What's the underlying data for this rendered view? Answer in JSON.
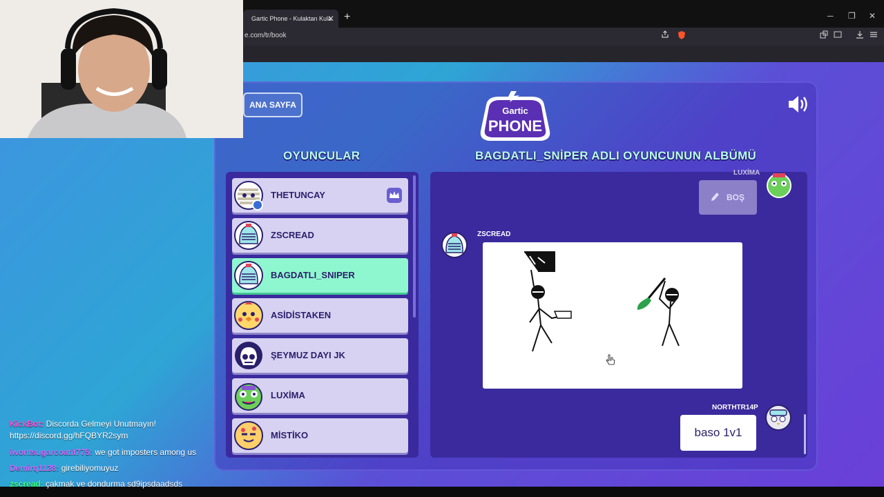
{
  "browser": {
    "tab_title": "Gartic Phone - Kulaktan Kula",
    "tab_close": "✕",
    "new_tab": "+",
    "url": "e.com/tr/book",
    "window_minimize": "─",
    "window_restore": "❐",
    "window_close": "✕"
  },
  "header": {
    "home_button": "ANA SAYFA",
    "logo_top": "Gartic",
    "logo_bottom": "PHONE"
  },
  "players_section": {
    "title": "OYUNCULAR",
    "players": [
      {
        "name": "THETUNCAY",
        "host": true
      },
      {
        "name": "ZSCREAD"
      },
      {
        "name": "BAGDATLI_SNIPER",
        "active": true
      },
      {
        "name": "ASİDİSTAKEN"
      },
      {
        "name": "ŞEYMUZ DAYI JK"
      },
      {
        "name": "LUXİMA"
      },
      {
        "name": "MİSTİKO"
      }
    ]
  },
  "album": {
    "title": "BAGDATLI_SNİPER ADLI OYUNCUNUN ALBÜMÜ",
    "top_player": "LUXİMA",
    "empty_label": "BOŞ",
    "drawing_player": "ZSCREAD",
    "answer_player": "NORTHTR14P",
    "answer_text": "baso 1v1"
  },
  "chat": {
    "messages": [
      {
        "user": "KickBot:",
        "text": " Discorda Gelmeyi Unutmayın!",
        "user_color": "#ff4fd0"
      },
      {
        "user": "",
        "text": "https://discord.gg/hFQBYR2sym",
        "user_color": "#ffffff"
      },
      {
        "user": "iwontsugarcoatit775:",
        "text": " we got imposters among us",
        "user_color": "#c86bff"
      },
      {
        "user": "Demirq1128:",
        "text": " girebiliyomuyuz",
        "user_color": "#c86bff"
      },
      {
        "user": "zscread:",
        "text": " çakmak ve dondurma sd9ipsdaadsds",
        "user_color": "#3cff7a"
      }
    ]
  },
  "colors": {
    "accent_mint": "#8ff7cf",
    "panel": "#3a2a9e",
    "title_text": "#b8ffe8"
  }
}
